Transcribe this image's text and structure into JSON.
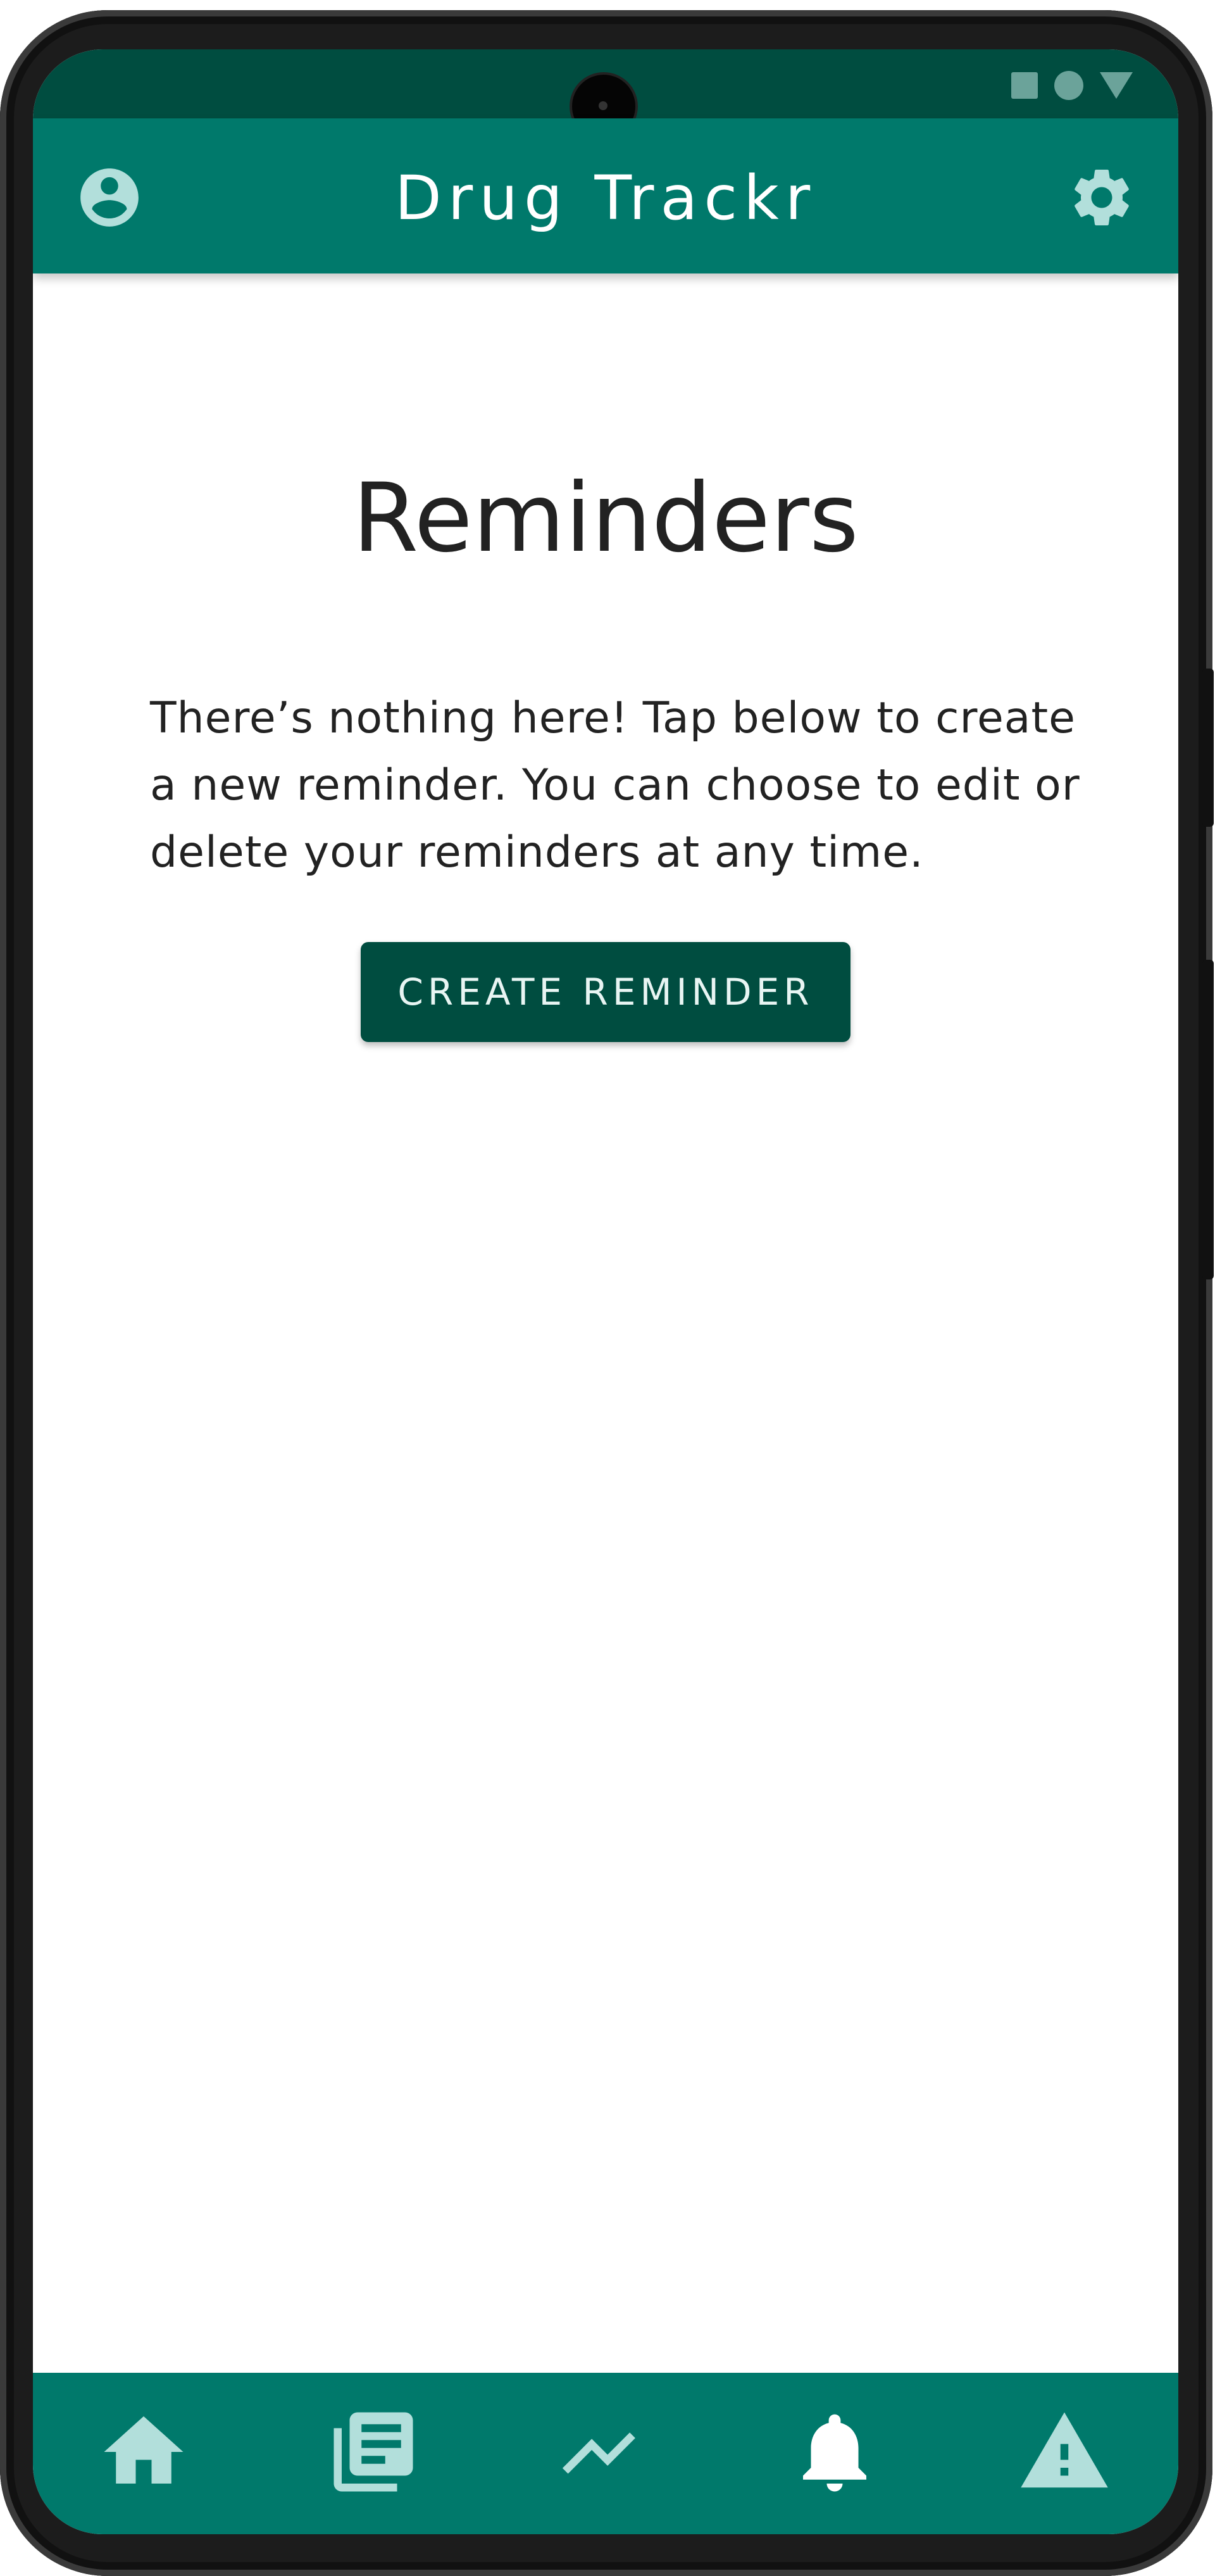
{
  "app": {
    "title": "Drug Trackr"
  },
  "colors": {
    "primary": "#00796b",
    "primary_dark": "#004d40",
    "icon_tint": "#b2dfdb",
    "active_icon": "#ffffff"
  },
  "header": {
    "profile_icon": "account-circle-icon",
    "settings_icon": "gear-icon"
  },
  "page": {
    "title": "Reminders",
    "empty_message": "There’s nothing here! Tap below to create a new reminder. You can choose to edit or delete your reminders at any time.",
    "create_button_label": "CREATE REMINDER"
  },
  "bottom_nav": {
    "items": [
      {
        "icon": "home-icon",
        "active": false
      },
      {
        "icon": "library-books-icon",
        "active": false
      },
      {
        "icon": "trending-up-icon",
        "active": false
      },
      {
        "icon": "bell-icon",
        "active": true
      },
      {
        "icon": "warning-icon",
        "active": false
      }
    ]
  }
}
